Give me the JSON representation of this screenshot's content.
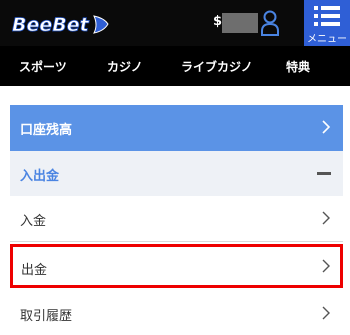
{
  "header": {
    "logo_text": "BeeBet",
    "balance_currency": "$",
    "menu_label": "メニュー"
  },
  "nav": {
    "items": [
      "スポーツ",
      "カジノ",
      "ライブカジノ",
      "特典"
    ]
  },
  "account_menu": {
    "balance_label": "口座残高",
    "section_label": "入出金",
    "deposit_label": "入金",
    "withdraw_label": "出金",
    "history_label": "取引履歴"
  },
  "colors": {
    "balance_row": "#5b93e6",
    "menu_button": "#2f5fd6",
    "highlight": "#ee0000"
  }
}
